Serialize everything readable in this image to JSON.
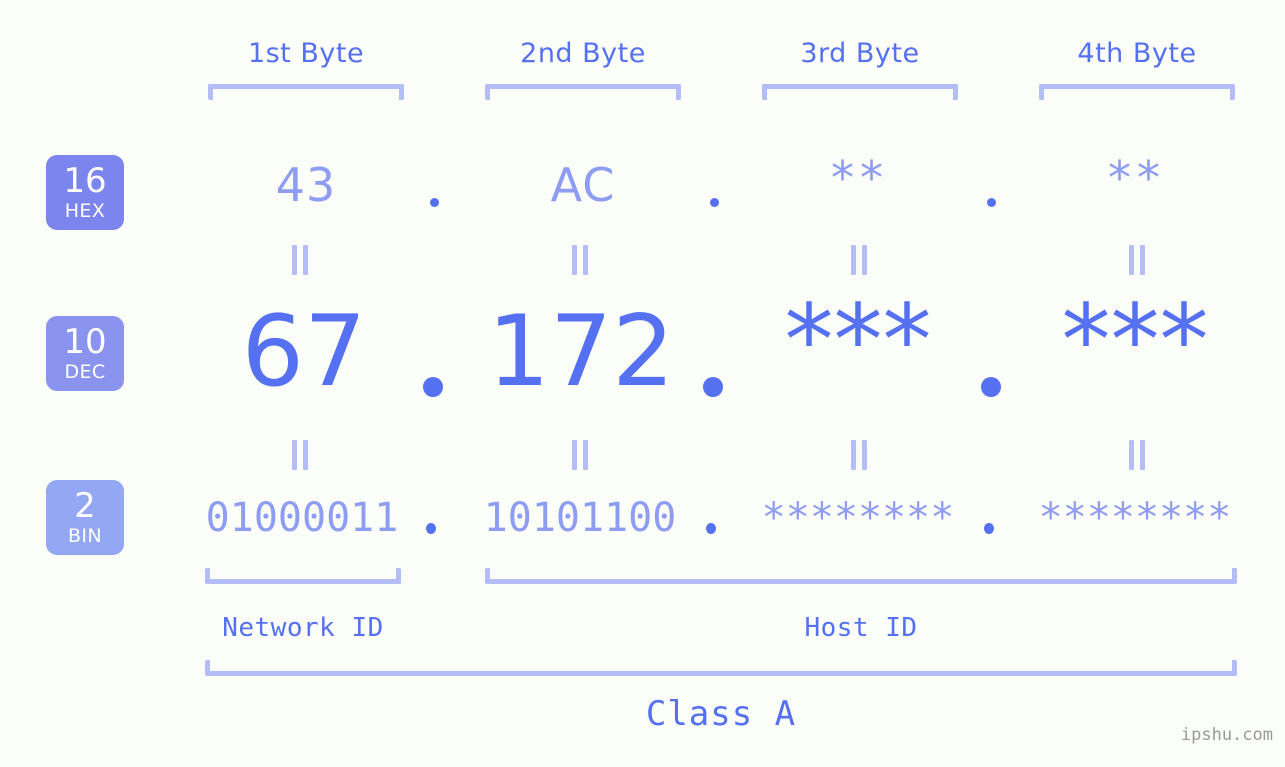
{
  "page": {
    "background_color": "#fbfdf8",
    "accent_strong": "#5570f1",
    "accent_light": "#8e9cf2",
    "bracket_color": "#b5bdf7",
    "badge_color": "#7b85ed",
    "watermark": "ipshu.com"
  },
  "headers": [
    {
      "label": "1st Byte"
    },
    {
      "label": "2nd Byte"
    },
    {
      "label": "3rd Byte"
    },
    {
      "label": "4th Byte"
    }
  ],
  "bases": [
    {
      "number": "16",
      "name": "HEX"
    },
    {
      "number": "10",
      "name": "DEC"
    },
    {
      "number": "2",
      "name": "BIN"
    }
  ],
  "rows": {
    "hex": {
      "base_number": "16",
      "base_name": "HEX",
      "bytes": [
        "43",
        "AC",
        "**",
        "**"
      ],
      "separator": "."
    },
    "dec": {
      "base_number": "10",
      "base_name": "DEC",
      "bytes": [
        "67",
        "172",
        "***",
        "***"
      ],
      "separator": "."
    },
    "bin": {
      "base_number": "2",
      "base_name": "BIN",
      "bytes": [
        "01000011",
        "10101100",
        "********",
        "********"
      ],
      "separator": "."
    }
  },
  "equals_marks": {
    "glyph": "||",
    "count_per_row": 4
  },
  "segments": {
    "network_id": "Network ID",
    "host_id": "Host ID",
    "class": "Class A"
  }
}
